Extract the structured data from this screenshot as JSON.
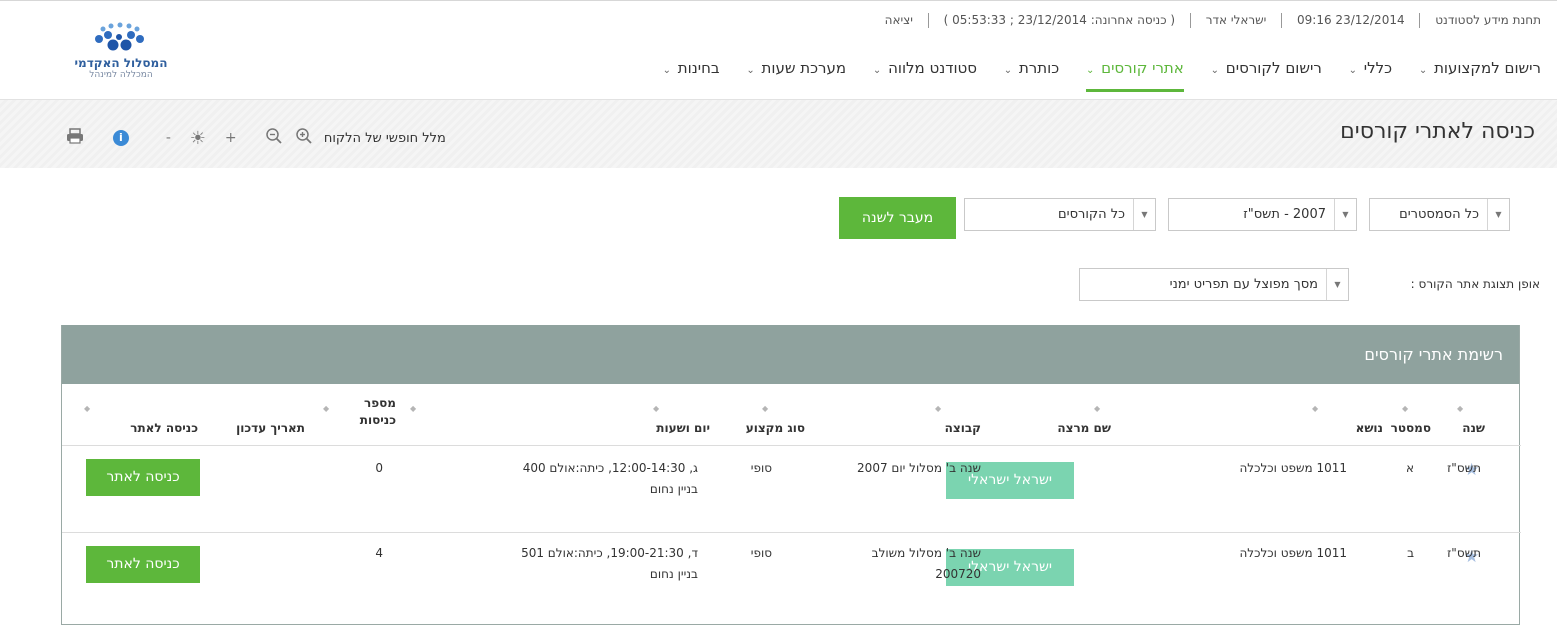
{
  "logo": {
    "name": "המסלול האקדמי",
    "sub": "המכללה למינהל"
  },
  "utility": {
    "system": "תחנת מידע לסטודנט",
    "datetime": "09:16 23/12/2014",
    "user": "ישראלי אדר",
    "last_login": "( כניסה אחרונה: 23/12/2014 ; 05:53:33 )",
    "logout": "יציאה"
  },
  "nav": {
    "items": [
      {
        "label": "רישום למקצועות",
        "active": false
      },
      {
        "label": "כללי",
        "active": false
      },
      {
        "label": "רישום לקורסים",
        "active": false
      },
      {
        "label": "אתרי קורסים",
        "active": true
      },
      {
        "label": "כותרת",
        "active": false
      },
      {
        "label": "סטודנט מלווה",
        "active": false
      },
      {
        "label": "מערכת שעות",
        "active": false
      },
      {
        "label": "בחינות",
        "active": false
      }
    ]
  },
  "page": {
    "title": "כניסה לאתרי קורסים"
  },
  "tools": {
    "accessibility_label": "מלל חופשי של הלקוח"
  },
  "filters": {
    "semester": "כל הסמסטרים",
    "year": "2007 - תשס\"ז",
    "courses": "כל הקורסים",
    "go_button": "מעבר לשנה"
  },
  "display": {
    "label": "אופן תצוגת אתר הקורס :",
    "value": "מסך מפוצל עם תפריט ימני"
  },
  "panel": {
    "title": "רשימת אתרי קורסים"
  },
  "table": {
    "headers": {
      "year": "שנה",
      "semester": "סמסטר",
      "subject": "נושא",
      "lecturer": "שם מרצה",
      "group": "קבוצה",
      "type": "סוג מקצוע",
      "schedule": "יום ושעות",
      "entries_1": "מספר",
      "entries_2": "כניסות",
      "updated": "תאריך עדכון",
      "enter": "כניסה לאתר"
    },
    "rows": [
      {
        "year": "תשס\"ז",
        "semester": "א",
        "subject": "1011 משפט וכלכלה",
        "lecturer": "ישראל ישראלי",
        "group_1": "שנה ב' מסלול יום 2007",
        "group_2": "",
        "type": "סופי",
        "schedule_1": "ג, 12:00-14:30, כיתה:אולם 400",
        "schedule_2": "בניין נחום",
        "entries": "0",
        "updated": "",
        "enter": "כניסה לאתר"
      },
      {
        "year": "תשס\"ז",
        "semester": "ב",
        "subject": "1011 משפט וכלכלה",
        "lecturer": "ישראל ישראלי",
        "group_1": "שנה ב' מסלול משולב",
        "group_2": "200720",
        "type": "סופי",
        "schedule_1": "ד, 19:00-21:30, כיתה:אולם 501",
        "schedule_2": "בניין נחום",
        "entries": "4",
        "updated": "",
        "enter": "כניסה לאתר"
      }
    ]
  },
  "colors": {
    "accent": "#5db73b",
    "lecturer_badge": "#7bd4b0",
    "panel_header": "#8fa29e",
    "logo_blue": "#2f5f9e"
  },
  "icons": [
    "logo-mark-icon",
    "print-icon",
    "info-icon",
    "contrast-icon",
    "zoom-in-icon",
    "zoom-out-icon",
    "favorite-star-icon",
    "sort-icon",
    "chevron-down-icon"
  ]
}
